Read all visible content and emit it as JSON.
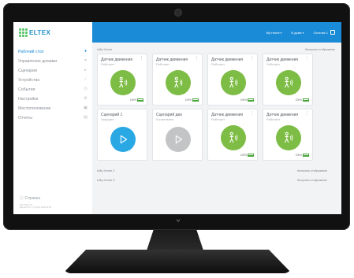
{
  "header": {
    "logo_text": "ELTEX",
    "home_selector": "My Home",
    "group_selector": "В доме",
    "user_label": "Охотник 1"
  },
  "sidebar": {
    "items": [
      {
        "label": "Рабочий стол",
        "icon": "pin-icon",
        "active": true
      },
      {
        "label": "Управление домами",
        "icon": "people-icon",
        "active": false
      },
      {
        "label": "Сценарии",
        "icon": "play-icon",
        "active": false
      },
      {
        "label": "Устройства",
        "icon": "pencil-icon",
        "active": false
      },
      {
        "label": "События",
        "icon": "clock-icon",
        "active": false
      },
      {
        "label": "Настройки",
        "icon": "gear-icon",
        "active": false
      },
      {
        "label": "Местоположение",
        "icon": "map-icon",
        "active": false
      },
      {
        "label": "Отчеты",
        "icon": "document-icon",
        "active": false
      }
    ],
    "help_label": "Справка",
    "footer_line1": "2017 Eltex.IO",
    "footer_line2": "Версия ПО: 1.7 RC(2) 2018-10 09"
  },
  "main": {
    "section1": {
      "title": "My Home",
      "configure": "Настроить отображение"
    },
    "section2": {
      "title": "My Home 2",
      "configure": "Настроить отображение"
    },
    "section3": {
      "title": "My Home 3",
      "configure": "Настроить отображение"
    },
    "cards": [
      {
        "title": "Датчик движения",
        "status": "Работает",
        "kind": "motion",
        "battery": "100%"
      },
      {
        "title": "Датчик движения",
        "status": "Работает",
        "kind": "motion",
        "battery": "100%"
      },
      {
        "title": "Датчик движения",
        "status": "Работает",
        "kind": "motion",
        "battery": "100%"
      },
      {
        "title": "Датчик движения",
        "status": "Работает",
        "kind": "motion",
        "battery": "100%"
      },
      {
        "title": "Сценарий 1",
        "status": "Запущен",
        "kind": "scenario-on"
      },
      {
        "title": "Сценарий два",
        "status": "Остановлен",
        "kind": "scenario-off"
      },
      {
        "title": "Датчик движения",
        "status": "Работает",
        "kind": "motion",
        "battery": "100%"
      },
      {
        "title": "Датчик движения",
        "status": "Работает",
        "kind": "motion",
        "battery": "100%"
      }
    ]
  },
  "colors": {
    "accent": "#1a8bd6",
    "sensor_green": "#7dbd45",
    "play_blue": "#2aa8e4",
    "stopped_grey": "#c2c4c6"
  }
}
